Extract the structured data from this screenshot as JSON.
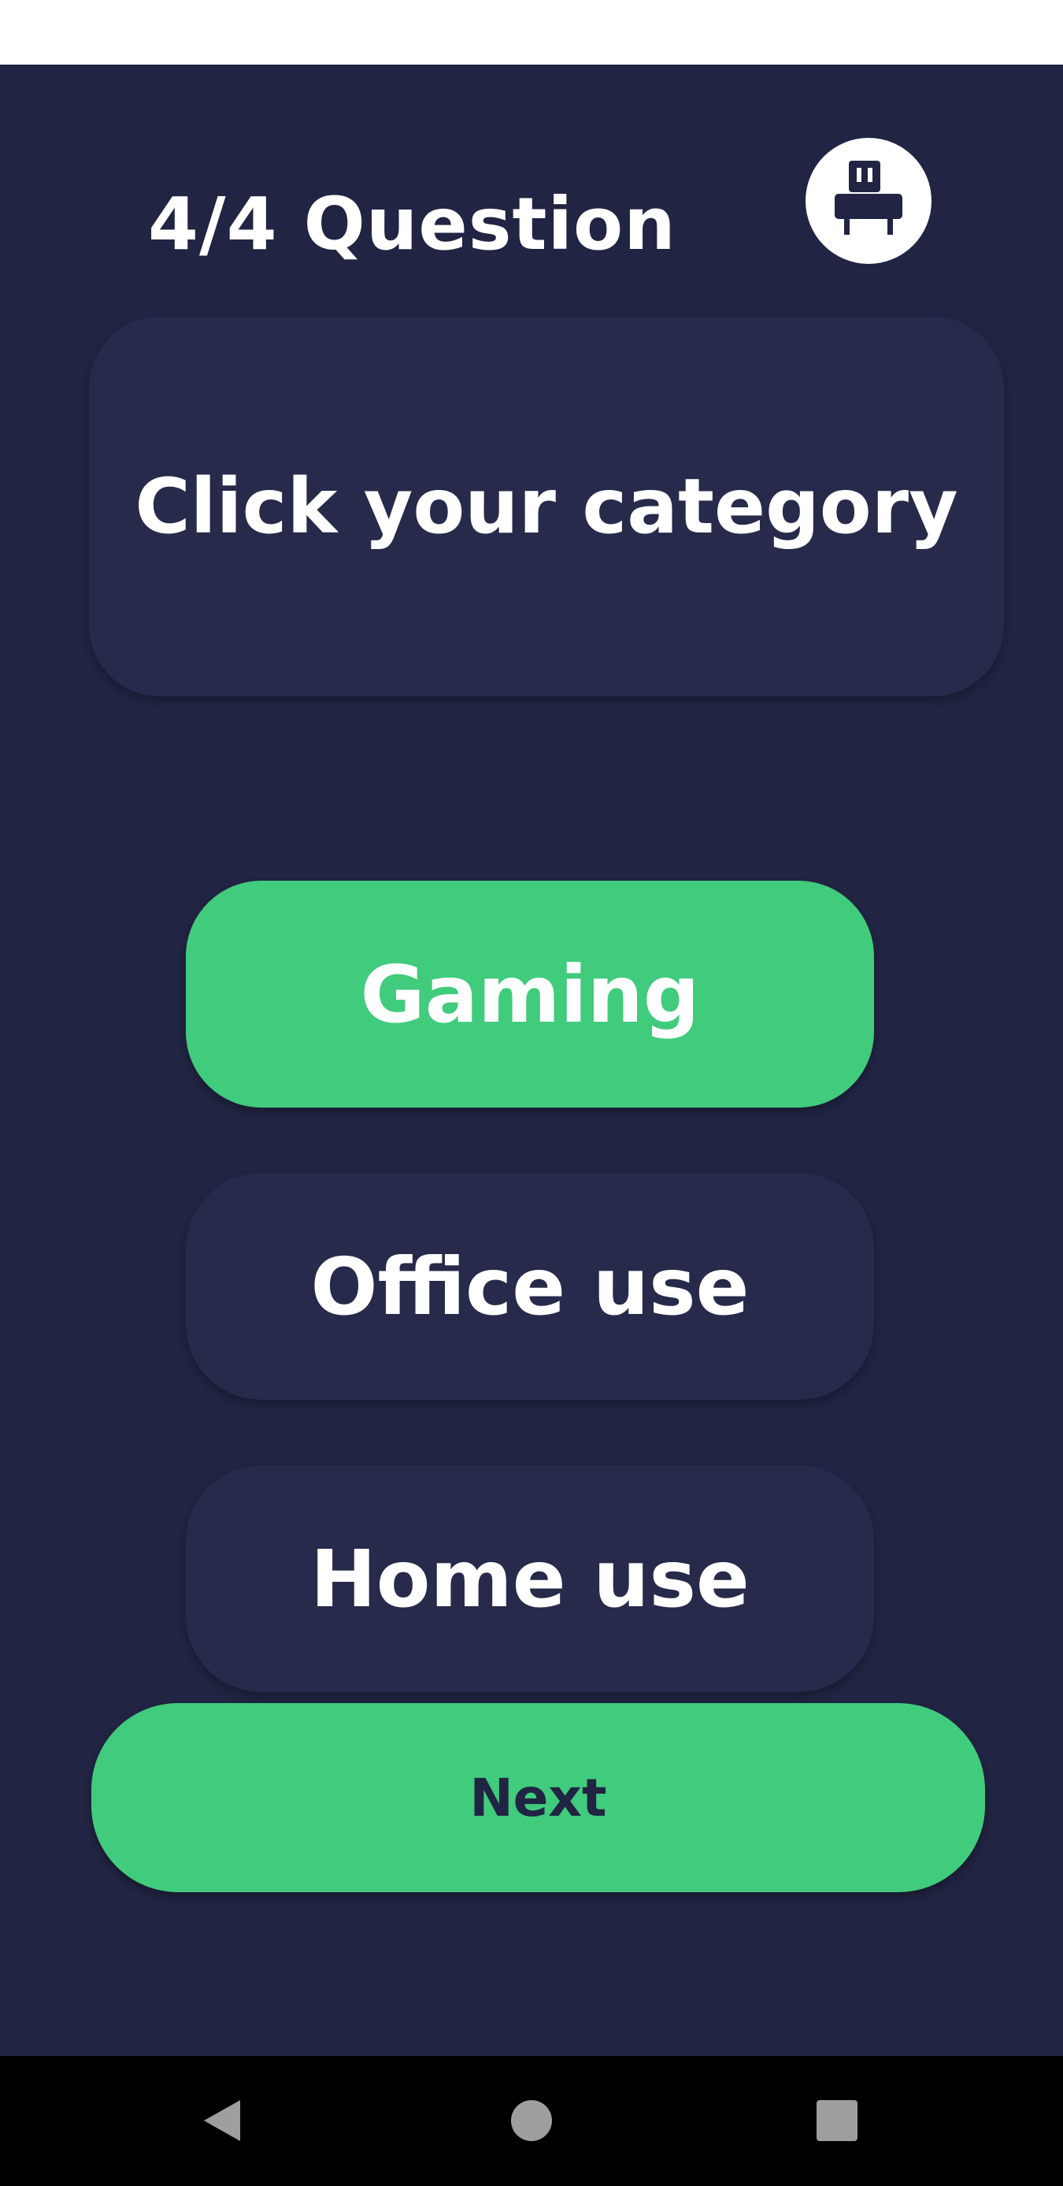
{
  "header": {
    "title": "4/4 Question",
    "avatar_icon": "robot-icon"
  },
  "question": {
    "text": "Click your category"
  },
  "options": [
    {
      "label": "Gaming",
      "selected": true
    },
    {
      "label": "Office use",
      "selected": false
    },
    {
      "label": "Home use",
      "selected": false
    }
  ],
  "next_button": {
    "label": "Next"
  },
  "nav": {
    "back_icon": "back-triangle-icon",
    "home_icon": "home-circle-icon",
    "recents_icon": "recents-square-icon"
  },
  "colors": {
    "background": "#212442",
    "card": "#272a4a",
    "accent": "#41cb7d",
    "text": "#ffffff"
  }
}
